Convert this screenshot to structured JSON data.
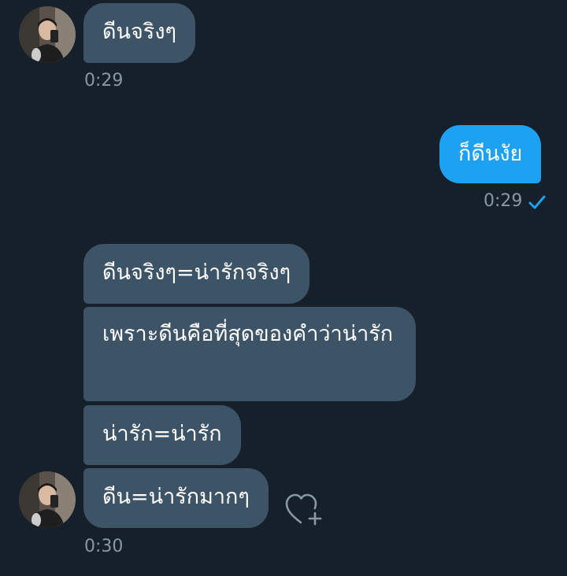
{
  "messages": {
    "m1": {
      "text": "ดีนจริงๆ",
      "time": "0:29"
    },
    "m2": {
      "text": "ก็ดีนงัย",
      "time": "0:29"
    },
    "m3": {
      "text": "ดีนจริงๆ=น่ารักจริงๆ"
    },
    "m4": {
      "text": "เพราะดีนคือที่สุดของคำว่าน่ารัก"
    },
    "m5": {
      "text": "น่ารัก=น่ารัก"
    },
    "m6": {
      "text": "ดีน=น่ารักมากๆ",
      "time": "0:30"
    }
  },
  "colors": {
    "background": "#16202b",
    "incoming_bubble": "#3d5366",
    "outgoing_bubble": "#1da1f2",
    "timestamp": "#8899a6",
    "read_check": "#1da1f2"
  },
  "icons": {
    "avatar": "user-photo",
    "read_receipt": "check-icon",
    "reaction": "heart-plus-icon"
  }
}
